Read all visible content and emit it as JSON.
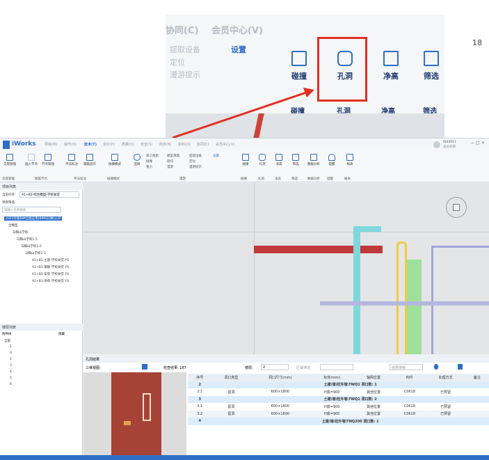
{
  "page_number": "18",
  "zoom": {
    "menu": [
      "协同(C)",
      "会员中心(V)"
    ],
    "small_items": [
      "提取设备",
      "设置",
      "定位",
      "漫游提示"
    ],
    "big_buttons": [
      "碰撞",
      "孔洞",
      "净高",
      "筛选"
    ],
    "groups": [
      "碰撞",
      "孔洞",
      "净高",
      "筛选"
    ]
  },
  "app": {
    "brand": "iWorks",
    "menu": [
      "项目(M)",
      "操作(O)",
      "技术(T)",
      "造价(P)",
      "质量(Q)",
      "安全(S)",
      "商务(B)",
      "资料(D)",
      "协同(C)",
      "会员中心(V)"
    ],
    "user": "fb43011",
    "user_sub": "会员权限",
    "window_controls": [
      "—",
      "□",
      "×"
    ],
    "ribbon": {
      "buttons": [
        "交底管理",
        "插入节点",
        "节点管理",
        "平法标注",
        "钢筋显示",
        "碰撞模式",
        "选择",
        "碰撞",
        "孔洞",
        "净高",
        "筛选",
        "数据分析",
        "提醒",
        "报表"
      ],
      "small": [
        "第三视角",
        "碰撞",
        "重力",
        "模型清理",
        "剖切",
        "漫游",
        "提取设备",
        "定位",
        "漫游提示",
        "设置"
      ],
      "groups": [
        "交底管理",
        "图纸节点",
        "平法标注",
        "碰撞模式",
        "漫游",
        "碰撞",
        "孔洞",
        "净高",
        "筛选",
        "数据分析",
        "提醒",
        "报表"
      ]
    },
    "left": {
      "title": "项目列表",
      "current_label": "当前打开:",
      "current_value": "A1+B1-综合模型-学校食堂",
      "filter_label": "项目筛选:",
      "search_placeholder": "请输入名称搜索",
      "tree": [
        "2022年版BIM全能应用(BIMS比赛)公开",
        "全模型",
        "马鞍山学校",
        "马鞍山学校1-5",
        "马鞍山学校1-5",
        "马鞍山学校1-5",
        "A1+B1-土建-学校食堂.YS",
        "A1+B1-钢筋-学校食堂.YS",
        "A1+B1-安装-学校食堂.YS",
        "A1+B1-场布-学校食堂.YS"
      ],
      "layer_title": "楼层列表",
      "layer_label": "构件树",
      "layer_hide": "隐藏",
      "layers": [
        "全部",
        "1",
        "0",
        "2",
        "3",
        "4",
        "5",
        "6"
      ]
    },
    "bottom": {
      "title": "孔洞结果",
      "view_label": "三维视图:",
      "count": "检查结果: 187",
      "floor_label": "楼层:",
      "floor_value": "2",
      "area_label": "区域筛选:",
      "search_placeholder": "结果搜索",
      "headers": [
        "序号",
        "洞口类型",
        "洞口尺寸(mm)",
        "标高(mm)",
        "轴网位置",
        "构件",
        "处理方式",
        "备注"
      ],
      "rows": [
        {
          "group": true,
          "num": "2",
          "text": "土建\\墙\\砼外墙\\TWQ1  洞口数: 1"
        },
        {
          "group": false,
          "cells": [
            "2.1",
            "留洞",
            "600×1800",
            "H底=900",
            "其他位置",
            "C0618",
            "已预留",
            ""
          ]
        },
        {
          "group": true,
          "num": "3",
          "text": "土建\\墙\\砼外墙\\TWQ1  洞口数: 2"
        },
        {
          "group": false,
          "cells": [
            "3.1",
            "留洞",
            "600×1800",
            "H底=900",
            "其他位置",
            "C0618",
            "已预留",
            ""
          ]
        },
        {
          "group": false,
          "cells": [
            "3.2",
            "留洞",
            "600×1800",
            "H底=900",
            "其他位置",
            "C0618",
            "已预留",
            ""
          ]
        },
        {
          "group": true,
          "num": "4",
          "text": "土建\\墙\\砼外墙\\TNQ200  洞口数: 1"
        }
      ]
    }
  }
}
